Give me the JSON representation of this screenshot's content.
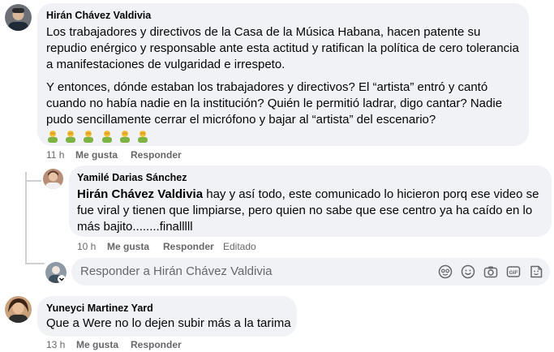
{
  "comments": [
    {
      "author": "Hirán Chávez Valdivia",
      "paragraph1": "Los trabajadores y directivos de la Casa de la Música Habana, hacen patente su repudio enérgico y responsable ante esta actitud y ratifican la política de cero tolerancia a manifestaciones de vulgaridad e irrespeto.",
      "paragraph2": "Y entonces, dónde estaban los trabajadores y directivos? El “artista” entró y cantó cuando no había nadie en la institución? Quién le permitió ladrar, digo cantar? Nadie pudo sencillamente cerrar el micrófono y bajar al “artista” del escenario?",
      "emoji_line": "🤦‍♂️🤦‍♂️🤦‍♂️🤦‍♂️🤦‍♂️🤦‍♂️",
      "time": "11 h",
      "like_label": "Me gusta",
      "reply_label": "Responder"
    },
    {
      "author": "Yamilé Darias Sánchez",
      "mention": "Hirán Chávez Valdivia",
      "text": " hay y así todo, este comunicado lo hicieron porq ese video se fue viral y tienen que limpiarse, pero quien no sabe que ese centro ya ha caído en lo más bajito........finalllll",
      "time": "10 h",
      "like_label": "Me gusta",
      "reply_label": "Responder",
      "edited_label": "Editado"
    },
    {
      "author": "Yuneyci Martinez Yard",
      "text": "Que a Were no lo dejen subir más a la tarima",
      "time": "13 h",
      "like_label": "Me gusta",
      "reply_label": "Responder"
    }
  ],
  "reply_box": {
    "placeholder": "Responder a Hirán Chávez Valdivia",
    "icons": [
      "avatar-icon",
      "emoji-icon",
      "camera-icon",
      "gif-icon",
      "sticker-icon"
    ]
  },
  "colors": {
    "bubble_bg": "#f0f2f5",
    "meta_text": "#65676b",
    "thread_line": "#ced0d4"
  }
}
